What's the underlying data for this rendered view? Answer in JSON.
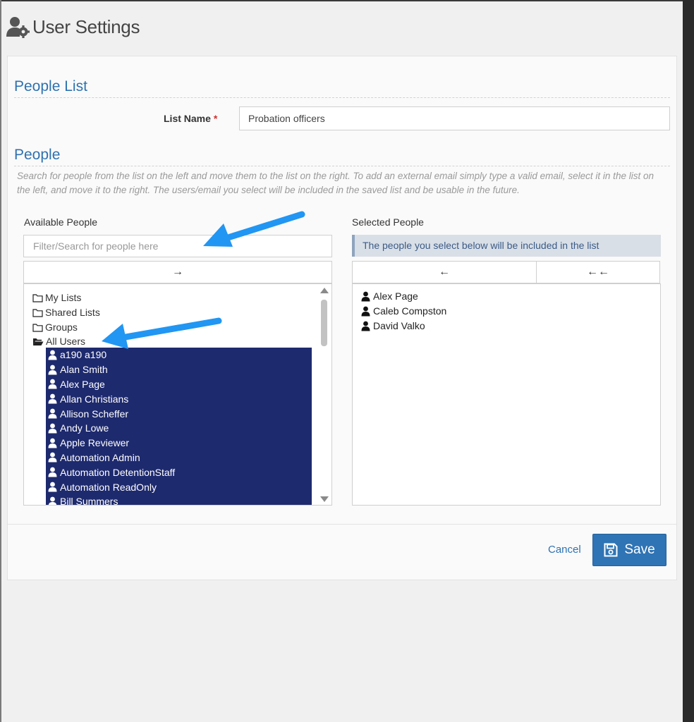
{
  "header": {
    "title": "User Settings",
    "icon": "user-gear-icon"
  },
  "people_list": {
    "section_title": "People List",
    "list_name_label": "List Name",
    "required_mark": "*",
    "list_name_value": "Probation officers"
  },
  "people": {
    "section_title": "People",
    "help_text": "Search for people from the list on the left and move them to the list on the right. To add an external email simply type a valid email, select it in the list on the left, and move it to the right. The users/email you select will be included in the saved list and be usable in the future.",
    "available_label": "Available People",
    "filter_placeholder": "Filter/Search for people here",
    "add_button": "→",
    "tree": {
      "my_lists": "My Lists",
      "shared_lists": "Shared Lists",
      "groups": "Groups",
      "all_users": "All Users"
    },
    "users": [
      "a190 a190",
      "Alan Smith",
      "Alex Page",
      "Allan Christians",
      "Allison Scheffer",
      "Andy Lowe",
      "Apple Reviewer",
      "Automation Admin",
      "Automation DetentionStaff",
      "Automation ReadOnly",
      "Bill Summers"
    ],
    "selected_label": "Selected People",
    "selected_info": "The people you select below will be included in the list",
    "remove_button": "←",
    "remove_all_button": "←←",
    "selected": [
      "Alex Page",
      "Caleb Compston",
      "David Valko"
    ]
  },
  "footer": {
    "cancel_label": "Cancel",
    "save_label": "Save"
  },
  "colors": {
    "accent": "#2e72b0",
    "selection": "#1e2a6e",
    "annotation_arrow": "#2196f3",
    "save_button": "#2f74b5"
  }
}
